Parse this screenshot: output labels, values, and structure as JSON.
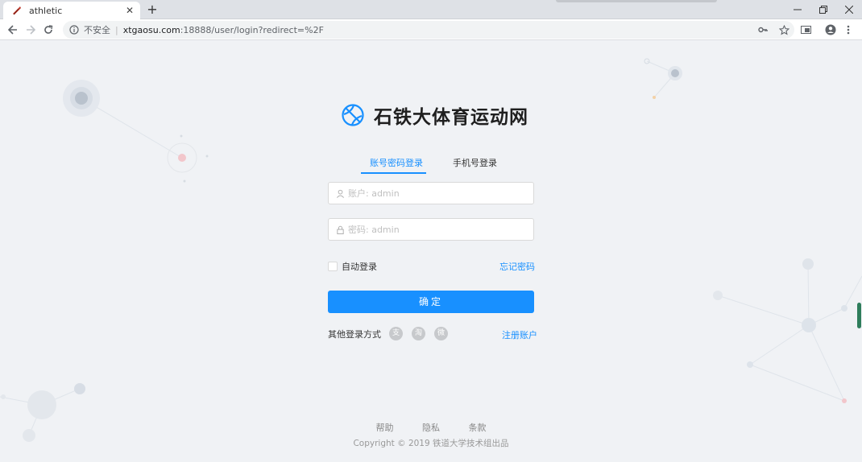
{
  "browser": {
    "tab_title": "athletic",
    "tab_close": "✕",
    "new_tab": "+",
    "url_secure_label": "不安全",
    "url_separator": "|",
    "url_host": "xtgaosu.com",
    "url_path": ":18888/user/login?redirect=%2F",
    "icons": [
      "back-icon",
      "forward-icon",
      "reload-icon",
      "info-icon",
      "key-icon",
      "star-icon",
      "cast-icon",
      "account-icon",
      "menu-icon"
    ]
  },
  "brand": {
    "name": "石铁大体育运动网",
    "logo_icon": "basketball-icon",
    "accent": "#1890ff"
  },
  "login": {
    "tabs": [
      {
        "label": "账号密码登录",
        "active": true
      },
      {
        "label": "手机号登录",
        "active": false
      }
    ],
    "username_placeholder": "账户: admin",
    "password_placeholder": "密码: admin",
    "remember_label": "自动登录",
    "remember_checked": false,
    "forgot_label": "忘记密码",
    "submit_label": "确定",
    "other_label": "其他登录方式",
    "social": [
      {
        "name": "alipay-icon",
        "glyph": "支"
      },
      {
        "name": "taobao-icon",
        "glyph": "淘"
      },
      {
        "name": "weibo-icon",
        "glyph": "微"
      }
    ],
    "register_label": "注册账户"
  },
  "footer": {
    "links": [
      "帮助",
      "隐私",
      "条款"
    ],
    "copyright": "Copyright © 2019 铁道大学技术组出品"
  }
}
